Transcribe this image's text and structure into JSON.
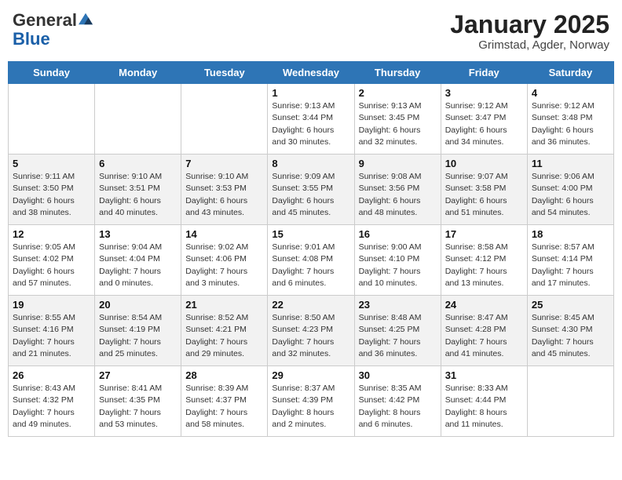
{
  "header": {
    "logo": {
      "line1": "General",
      "line2": "Blue"
    },
    "title": "January 2025",
    "subtitle": "Grimstad, Agder, Norway"
  },
  "weekdays": [
    "Sunday",
    "Monday",
    "Tuesday",
    "Wednesday",
    "Thursday",
    "Friday",
    "Saturday"
  ],
  "weeks": [
    [
      {
        "day": "",
        "info": ""
      },
      {
        "day": "",
        "info": ""
      },
      {
        "day": "",
        "info": ""
      },
      {
        "day": "1",
        "info": "Sunrise: 9:13 AM\nSunset: 3:44 PM\nDaylight: 6 hours and 30 minutes."
      },
      {
        "day": "2",
        "info": "Sunrise: 9:13 AM\nSunset: 3:45 PM\nDaylight: 6 hours and 32 minutes."
      },
      {
        "day": "3",
        "info": "Sunrise: 9:12 AM\nSunset: 3:47 PM\nDaylight: 6 hours and 34 minutes."
      },
      {
        "day": "4",
        "info": "Sunrise: 9:12 AM\nSunset: 3:48 PM\nDaylight: 6 hours and 36 minutes."
      }
    ],
    [
      {
        "day": "5",
        "info": "Sunrise: 9:11 AM\nSunset: 3:50 PM\nDaylight: 6 hours and 38 minutes."
      },
      {
        "day": "6",
        "info": "Sunrise: 9:10 AM\nSunset: 3:51 PM\nDaylight: 6 hours and 40 minutes."
      },
      {
        "day": "7",
        "info": "Sunrise: 9:10 AM\nSunset: 3:53 PM\nDaylight: 6 hours and 43 minutes."
      },
      {
        "day": "8",
        "info": "Sunrise: 9:09 AM\nSunset: 3:55 PM\nDaylight: 6 hours and 45 minutes."
      },
      {
        "day": "9",
        "info": "Sunrise: 9:08 AM\nSunset: 3:56 PM\nDaylight: 6 hours and 48 minutes."
      },
      {
        "day": "10",
        "info": "Sunrise: 9:07 AM\nSunset: 3:58 PM\nDaylight: 6 hours and 51 minutes."
      },
      {
        "day": "11",
        "info": "Sunrise: 9:06 AM\nSunset: 4:00 PM\nDaylight: 6 hours and 54 minutes."
      }
    ],
    [
      {
        "day": "12",
        "info": "Sunrise: 9:05 AM\nSunset: 4:02 PM\nDaylight: 6 hours and 57 minutes."
      },
      {
        "day": "13",
        "info": "Sunrise: 9:04 AM\nSunset: 4:04 PM\nDaylight: 7 hours and 0 minutes."
      },
      {
        "day": "14",
        "info": "Sunrise: 9:02 AM\nSunset: 4:06 PM\nDaylight: 7 hours and 3 minutes."
      },
      {
        "day": "15",
        "info": "Sunrise: 9:01 AM\nSunset: 4:08 PM\nDaylight: 7 hours and 6 minutes."
      },
      {
        "day": "16",
        "info": "Sunrise: 9:00 AM\nSunset: 4:10 PM\nDaylight: 7 hours and 10 minutes."
      },
      {
        "day": "17",
        "info": "Sunrise: 8:58 AM\nSunset: 4:12 PM\nDaylight: 7 hours and 13 minutes."
      },
      {
        "day": "18",
        "info": "Sunrise: 8:57 AM\nSunset: 4:14 PM\nDaylight: 7 hours and 17 minutes."
      }
    ],
    [
      {
        "day": "19",
        "info": "Sunrise: 8:55 AM\nSunset: 4:16 PM\nDaylight: 7 hours and 21 minutes."
      },
      {
        "day": "20",
        "info": "Sunrise: 8:54 AM\nSunset: 4:19 PM\nDaylight: 7 hours and 25 minutes."
      },
      {
        "day": "21",
        "info": "Sunrise: 8:52 AM\nSunset: 4:21 PM\nDaylight: 7 hours and 29 minutes."
      },
      {
        "day": "22",
        "info": "Sunrise: 8:50 AM\nSunset: 4:23 PM\nDaylight: 7 hours and 32 minutes."
      },
      {
        "day": "23",
        "info": "Sunrise: 8:48 AM\nSunset: 4:25 PM\nDaylight: 7 hours and 36 minutes."
      },
      {
        "day": "24",
        "info": "Sunrise: 8:47 AM\nSunset: 4:28 PM\nDaylight: 7 hours and 41 minutes."
      },
      {
        "day": "25",
        "info": "Sunrise: 8:45 AM\nSunset: 4:30 PM\nDaylight: 7 hours and 45 minutes."
      }
    ],
    [
      {
        "day": "26",
        "info": "Sunrise: 8:43 AM\nSunset: 4:32 PM\nDaylight: 7 hours and 49 minutes."
      },
      {
        "day": "27",
        "info": "Sunrise: 8:41 AM\nSunset: 4:35 PM\nDaylight: 7 hours and 53 minutes."
      },
      {
        "day": "28",
        "info": "Sunrise: 8:39 AM\nSunset: 4:37 PM\nDaylight: 7 hours and 58 minutes."
      },
      {
        "day": "29",
        "info": "Sunrise: 8:37 AM\nSunset: 4:39 PM\nDaylight: 8 hours and 2 minutes."
      },
      {
        "day": "30",
        "info": "Sunrise: 8:35 AM\nSunset: 4:42 PM\nDaylight: 8 hours and 6 minutes."
      },
      {
        "day": "31",
        "info": "Sunrise: 8:33 AM\nSunset: 4:44 PM\nDaylight: 8 hours and 11 minutes."
      },
      {
        "day": "",
        "info": ""
      }
    ]
  ]
}
